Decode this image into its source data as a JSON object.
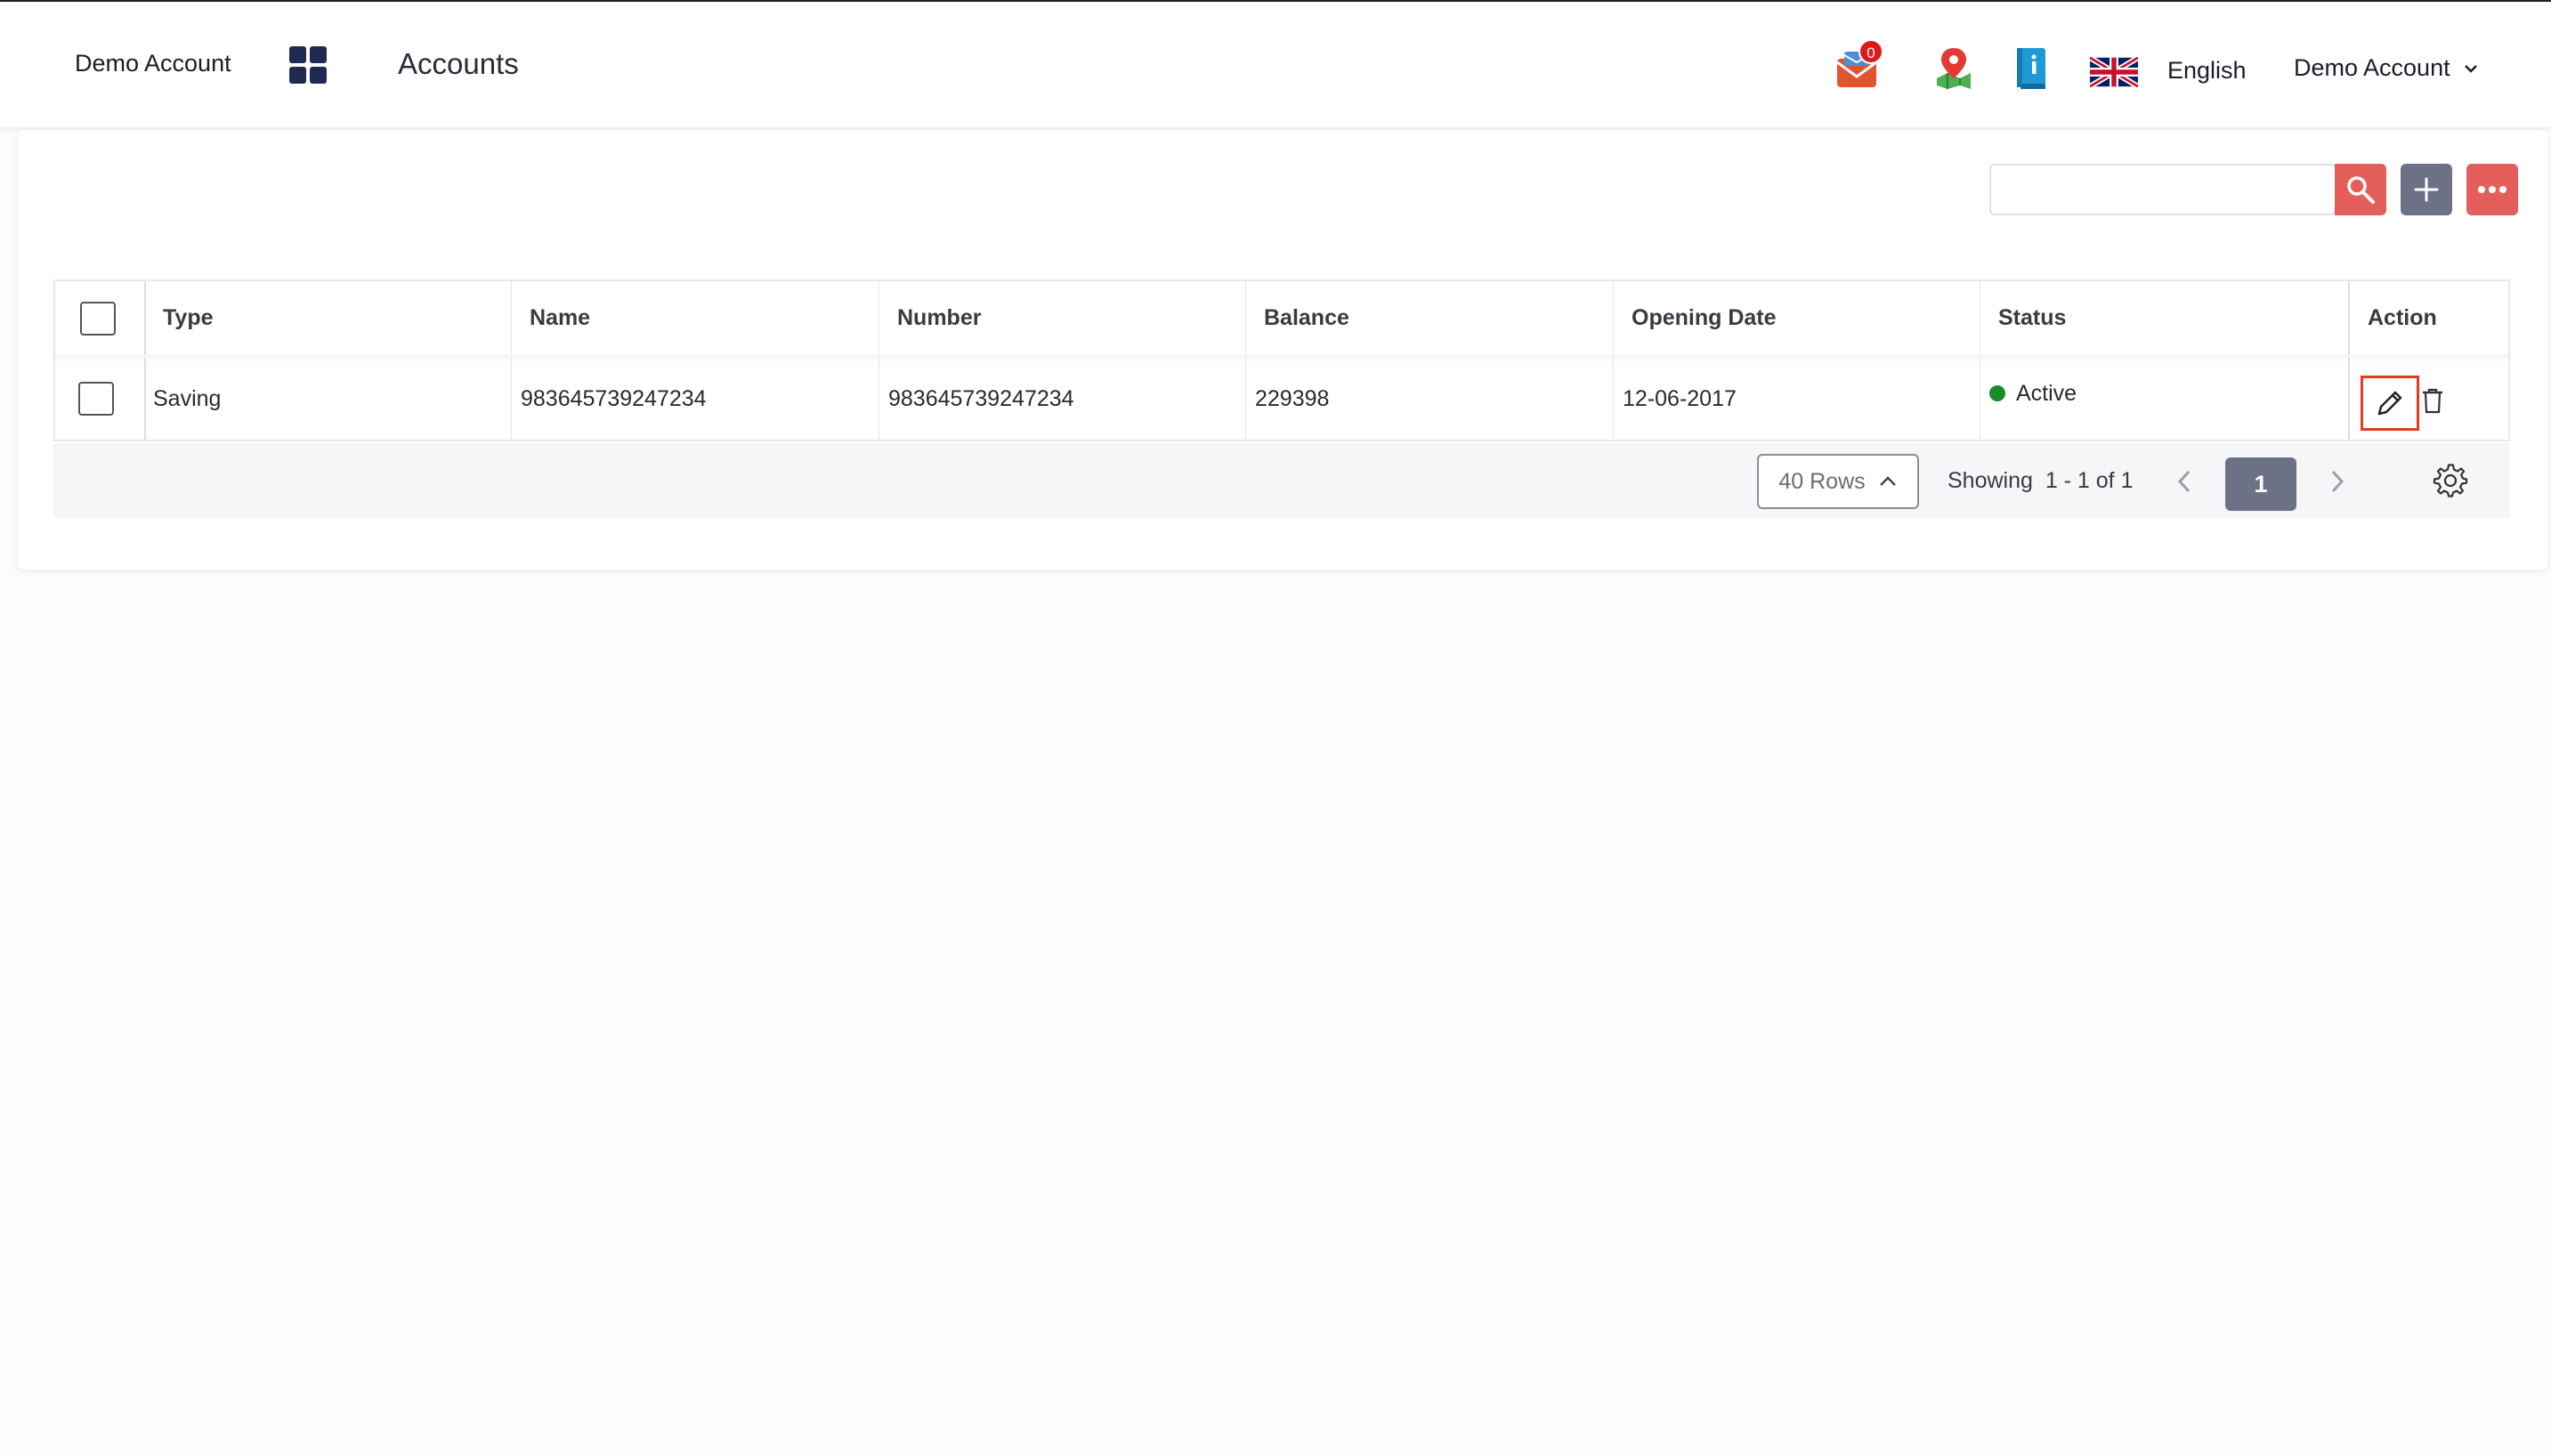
{
  "header": {
    "brand": "Demo Account",
    "page_title": "Accounts",
    "notification_count": "0",
    "language": "English",
    "user_menu_label": "Demo Account"
  },
  "toolbar": {
    "search_placeholder": "",
    "icons": {
      "search": "search-icon",
      "add": "plus-icon",
      "more": "more-icon"
    }
  },
  "table": {
    "columns": [
      "Type",
      "Name",
      "Number",
      "Balance",
      "Opening Date",
      "Status",
      "Action"
    ],
    "rows": [
      {
        "type": "Saving",
        "name": "983645739247234",
        "number": "983645739247234",
        "balance": "229398",
        "opening_date": "12-06-2017",
        "status": "Active"
      }
    ]
  },
  "pagination": {
    "rows_label": "40 Rows",
    "showing_label": "Showing",
    "range": "1 - 1 of 1",
    "current_page": "1"
  },
  "colors": {
    "accent_red": "#e45f5c",
    "accent_slate": "#6d7186",
    "status_active": "#1a8a2a",
    "highlight": "#e33a22"
  }
}
